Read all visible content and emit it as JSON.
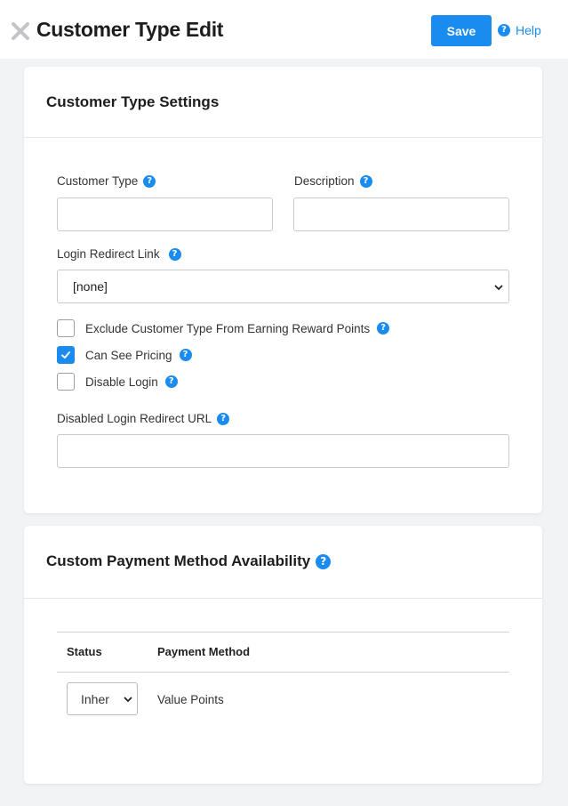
{
  "header": {
    "title": "Customer Type Edit",
    "save_label": "Save",
    "help_label": "Help"
  },
  "settings": {
    "title": "Customer Type Settings",
    "customer_type": {
      "label": "Customer Type",
      "value": ""
    },
    "description": {
      "label": "Description",
      "value": ""
    },
    "login_redirect": {
      "label": "Login Redirect Link",
      "selected": "[none]"
    },
    "checkboxes": [
      {
        "label": "Exclude Customer Type From Earning Reward Points",
        "checked": false
      },
      {
        "label": "Can See Pricing",
        "checked": true
      },
      {
        "label": "Disable Login",
        "checked": false
      }
    ],
    "disabled_redirect": {
      "label": "Disabled Login Redirect URL",
      "value": ""
    }
  },
  "payment": {
    "title": "Custom Payment Method Availability",
    "columns": [
      "Status",
      "Payment Method"
    ],
    "rows": [
      {
        "status": "Inher",
        "method": "Value Points"
      }
    ]
  },
  "colors": {
    "accent": "#1a8cf0",
    "background": "#f2f3f5"
  },
  "icons": {
    "close": "close-icon",
    "help": "question-circle-icon",
    "dropdown": "chevron-down-icon",
    "check": "check-icon"
  }
}
